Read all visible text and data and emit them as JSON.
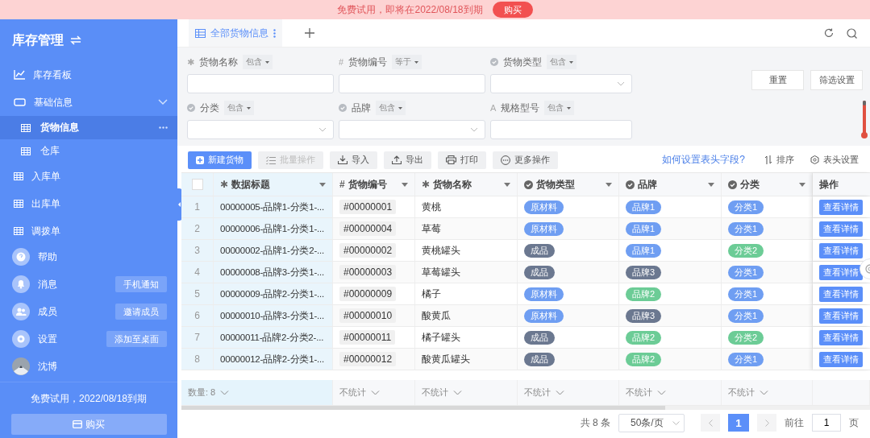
{
  "banner": {
    "text": "免费试用，即将在2022/08/18到期",
    "buy_label": "购买"
  },
  "sidebar": {
    "title": "库存管理",
    "nav": [
      {
        "label": "库存看板",
        "kind": "chart",
        "selected": false
      },
      {
        "label": "基础信息",
        "kind": "folder",
        "selected": false,
        "expanded": true,
        "children": [
          {
            "label": "货物信息",
            "kind": "table",
            "selected": true
          },
          {
            "label": "仓库",
            "kind": "table",
            "selected": false
          }
        ]
      },
      {
        "label": "入库单",
        "kind": "table",
        "selected": false
      },
      {
        "label": "出库单",
        "kind": "table",
        "selected": false
      },
      {
        "label": "调拨单",
        "kind": "table",
        "selected": false
      }
    ],
    "tools": [
      {
        "label": "帮助",
        "kind": "help"
      },
      {
        "label": "消息",
        "kind": "bell",
        "action": "手机通知"
      },
      {
        "label": "成员",
        "kind": "members",
        "action": "邀请成员"
      },
      {
        "label": "设置",
        "kind": "gear",
        "action": "添加至桌面"
      },
      {
        "label": "沈博",
        "kind": "avatar"
      }
    ],
    "trial_text": "免费试用，2022/08/18到期",
    "buy_label": "购买"
  },
  "tabs": [
    {
      "label": "全部货物信息",
      "selected": true
    }
  ],
  "filters": [
    {
      "label": "货物名称",
      "symbol": "✱",
      "op": "包含",
      "kind": "input"
    },
    {
      "label": "货物编号",
      "symbol": "#",
      "op": "等于",
      "kind": "input"
    },
    {
      "label": "货物类型",
      "op": "包含",
      "kind": "select"
    },
    {
      "label": "分类",
      "op": "包含",
      "kind": "select"
    },
    {
      "label": "品牌",
      "op": "包含",
      "kind": "select"
    },
    {
      "label": "规格型号",
      "symbol": "A",
      "op": "包含",
      "kind": "input"
    }
  ],
  "filter_buttons": [
    "重置",
    "筛选设置"
  ],
  "toolbar": {
    "buttons": [
      {
        "label": "新建货物",
        "kind": "add",
        "primary": true,
        "disabled": false
      },
      {
        "label": "批量操作",
        "kind": "batch",
        "primary": false,
        "disabled": true
      },
      {
        "label": "导入",
        "kind": "import",
        "primary": false,
        "disabled": false
      },
      {
        "label": "导出",
        "kind": "export",
        "primary": false,
        "disabled": false
      },
      {
        "label": "打印",
        "kind": "print",
        "primary": false,
        "disabled": false
      },
      {
        "label": "更多操作",
        "kind": "more",
        "primary": false,
        "disabled": false
      }
    ],
    "help_link": "如何设置表头字段?",
    "sort_label": "排序",
    "header_settings_label": "表头设置"
  },
  "table": {
    "select_all": {
      "checked": false
    },
    "columns": [
      {
        "label": "数据标题",
        "symbol": "✱"
      },
      {
        "label": "货物编号",
        "symbol": "#"
      },
      {
        "label": "货物名称",
        "symbol": "✱"
      },
      {
        "label": "货物类型"
      },
      {
        "label": "品牌"
      },
      {
        "label": "分类"
      },
      {
        "label": "操作"
      }
    ],
    "rows": [
      {
        "index": "1",
        "title": "00000005-品牌1-分类1-...",
        "code": "#00000001",
        "name": "黄桃",
        "type": {
          "label": "原材料",
          "color": "#6f9ef2"
        },
        "brand": {
          "label": "品牌1",
          "color": "#6f9ef2"
        },
        "category": {
          "label": "分类1",
          "color": "#6f9ef2"
        },
        "action": "查看详情"
      },
      {
        "index": "2",
        "title": "00000006-品牌1-分类1-...",
        "code": "#00000004",
        "name": "草莓",
        "type": {
          "label": "原材料",
          "color": "#6f9ef2"
        },
        "brand": {
          "label": "品牌1",
          "color": "#6f9ef2"
        },
        "category": {
          "label": "分类1",
          "color": "#6f9ef2"
        },
        "action": "查看详情"
      },
      {
        "index": "3",
        "title": "00000002-品牌1-分类2-...",
        "code": "#00000002",
        "name": "黄桃罐头",
        "type": {
          "label": "成品",
          "color": "#6b7890"
        },
        "brand": {
          "label": "品牌1",
          "color": "#6f9ef2"
        },
        "category": {
          "label": "分类2",
          "color": "#6ccc96"
        },
        "action": "查看详情"
      },
      {
        "index": "4",
        "title": "00000008-品牌3-分类1-...",
        "code": "#00000003",
        "name": "草莓罐头",
        "type": {
          "label": "成品",
          "color": "#6b7890"
        },
        "brand": {
          "label": "品牌3",
          "color": "#6b7890"
        },
        "category": {
          "label": "分类1",
          "color": "#6f9ef2"
        },
        "action": "查看详情"
      },
      {
        "index": "5",
        "title": "00000009-品牌2-分类1-...",
        "code": "#00000009",
        "name": "橘子",
        "type": {
          "label": "原材料",
          "color": "#6f9ef2"
        },
        "brand": {
          "label": "品牌2",
          "color": "#6ccc96"
        },
        "category": {
          "label": "分类1",
          "color": "#6f9ef2"
        },
        "action": "查看详情"
      },
      {
        "index": "6",
        "title": "00000010-品牌3-分类1-...",
        "code": "#00000010",
        "name": "酸黄瓜",
        "type": {
          "label": "原材料",
          "color": "#6f9ef2"
        },
        "brand": {
          "label": "品牌3",
          "color": "#6b7890"
        },
        "category": {
          "label": "分类1",
          "color": "#6f9ef2"
        },
        "action": "查看详情"
      },
      {
        "index": "7",
        "title": "00000011-品牌2-分类2-...",
        "code": "#00000011",
        "name": "橘子罐头",
        "type": {
          "label": "成品",
          "color": "#6b7890"
        },
        "brand": {
          "label": "品牌2",
          "color": "#6ccc96"
        },
        "category": {
          "label": "分类2",
          "color": "#6ccc96"
        },
        "action": "查看详情"
      },
      {
        "index": "8",
        "title": "00000012-品牌2-分类1-...",
        "code": "#00000012",
        "name": "酸黄瓜罐头",
        "type": {
          "label": "成品",
          "color": "#6b7890"
        },
        "brand": {
          "label": "品牌2",
          "color": "#6ccc96"
        },
        "category": {
          "label": "分类1",
          "color": "#6f9ef2"
        },
        "action": "查看详情"
      }
    ],
    "summary": [
      "数量: 8",
      "不统计",
      "不统计",
      "不统计",
      "不统计",
      "不统计"
    ]
  },
  "pagination": {
    "total": "共 8 条",
    "page_size": "50条/页",
    "pages": [
      {
        "label": "1",
        "selected": true
      }
    ],
    "goto_label": "前往",
    "goto_value": "1",
    "unit": "页"
  }
}
